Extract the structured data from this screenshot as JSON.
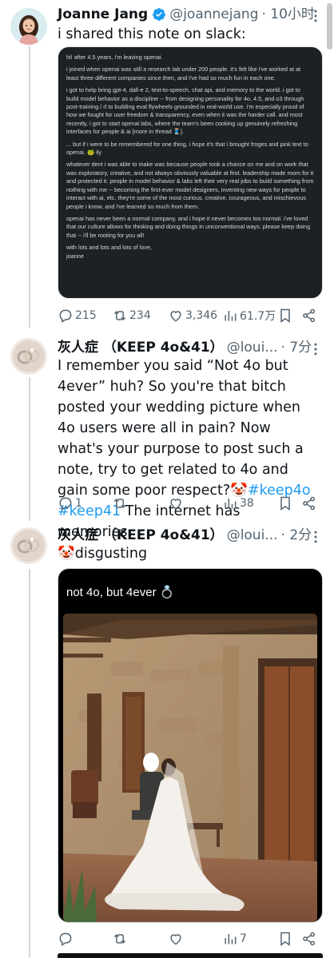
{
  "tweet1": {
    "name": "Joanne Jang",
    "handle": "@joannejang",
    "time": "· 10小时",
    "text": "i shared this note on slack:",
    "note_paragraphs": [
      "hi! after 4.5 years, i'm leaving openai.",
      "i joined when openai was still a research lab under 200 people. it's felt like i've worked at at least three different companies since then, and i've had so much fun in each one.",
      "i got to help bring gpt-4, dall-e 2, text-to-speech, chat api, and memory to the world. i got to build model behavior as a discipline -- from designing personality for 4o, 4.5, and o3 through post-training / rl to building eval flywheels grounded in real-world use. i'm especially proud of how we fought for user freedom & transparency, even when it was the harder call. and most recently, i got to start openai labs, where the team's been cooking up genuinely refreshing interfaces for people & ai [more in thread 🧵].",
      "... but if i were to be remembered for one thing, i hope it's that i brought froges and pink text to openai. 🐸 ily",
      "whatever dent i was able to make was because people took a chance on me and on work that was exploratory, creative, and not always obviously valuable at first. leadership made room for it and protected it. people in model behavior & labs left their very real jobs to build something from nothing with me -- becoming the first-ever model designers, inventing new ways for people to interact with ai, etc. they're some of the most curious, creative, courageous, and mischievous people i know, and i've learned so much from them.",
      "openai has never been a normal company, and i hope it never becomes too normal. i've loved that our culture allows for thinking and doing things in unconventional ways. please keep doing that -- i'll be rooting for you all!",
      "with lots and lots and lots of love,\njoanne"
    ],
    "replies": "215",
    "reposts": "234",
    "likes": "3,346",
    "views": "61.7万"
  },
  "tweet2": {
    "name": "灰人症 （KEEP 4o&41）",
    "handle": "@loui...",
    "time": "· 7分",
    "text_before": "I remember you said “Not 4o but 4ever” huh?  So you're that bitch posted your wedding picture when 4o users were all in pain? Now what's your purpose to post such a note, try to get related to 4o and gain some poor respect?🤡",
    "hashtag1": "#keep4o",
    "hashtag2": "#keep41",
    "text_after": " The internet has memories.",
    "replies": "1",
    "views": "38"
  },
  "tweet3": {
    "name": "灰人症 （KEEP 4o&41）",
    "handle": "@loui...",
    "time": "· 2分",
    "text": "🤡disgusting",
    "photo_caption": "not 4o, but 4ever 💍",
    "views": "7"
  },
  "colors": {
    "accent": "#1d9bf0",
    "secondary_text": "#536471",
    "note_bg": "#1e2124"
  }
}
